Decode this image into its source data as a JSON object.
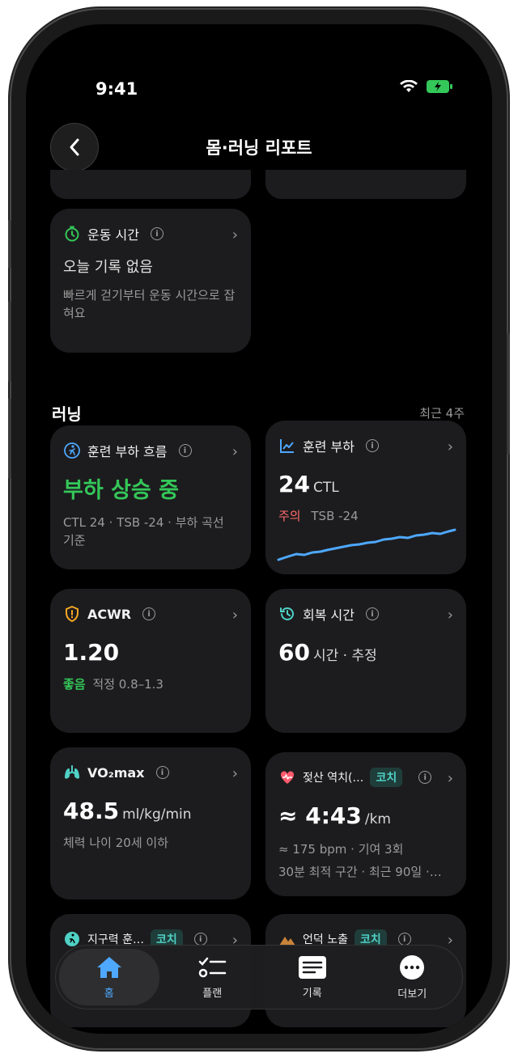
{
  "status": {
    "time": "9:41"
  },
  "nav": {
    "title": "몸·러닝 리포트"
  },
  "exercise_card": {
    "title": "운동 시간",
    "main": "오늘 기록 없음",
    "desc": "빠르게 걷기부터 운동 시간으로 잡혀요"
  },
  "section": {
    "title": "러닝",
    "period": "최근 4주"
  },
  "load_flow": {
    "title": "훈련 부하 흐름",
    "main": "부하 상승 중",
    "desc": "CTL 24 · TSB -24 · 부하 곡선 기준"
  },
  "training_load": {
    "title": "훈련 부하",
    "value": "24",
    "unit": "CTL",
    "status": "주의",
    "tsb": "TSB -24"
  },
  "acwr": {
    "title": "ACWR",
    "value": "1.20",
    "status": "좋음",
    "range": "적정 0.8–1.3"
  },
  "recovery": {
    "title": "회복 시간",
    "value": "60",
    "unit": "시간 · 추정"
  },
  "vo2": {
    "title": "VO₂max",
    "value": "48.5",
    "unit": "ml/kg/min",
    "desc": "체력 나이 20세 이하"
  },
  "lactate": {
    "title": "젖산 역치(…",
    "badge": "코치",
    "value": "≈ 4:43",
    "unit": "/km",
    "line1": "≈ 175 bpm · 기여 3회",
    "line2": "30분 최적 구간 · 최근 90일 ·…"
  },
  "endurance": {
    "title": "지구력 훈…",
    "badge": "코치"
  },
  "hill": {
    "title": "언덕 노출",
    "badge": "코치"
  },
  "tabs": [
    {
      "label": "홈",
      "icon": "home-icon"
    },
    {
      "label": "플랜",
      "icon": "plan-list-icon"
    },
    {
      "label": "기록",
      "icon": "record-icon"
    },
    {
      "label": "더보기",
      "icon": "more-icon"
    }
  ],
  "colors": {
    "green": "#34c759",
    "blue": "#4ea8ff",
    "red": "#ff6b6b",
    "orange": "#f5a623",
    "teal": "#4fd1c5"
  }
}
